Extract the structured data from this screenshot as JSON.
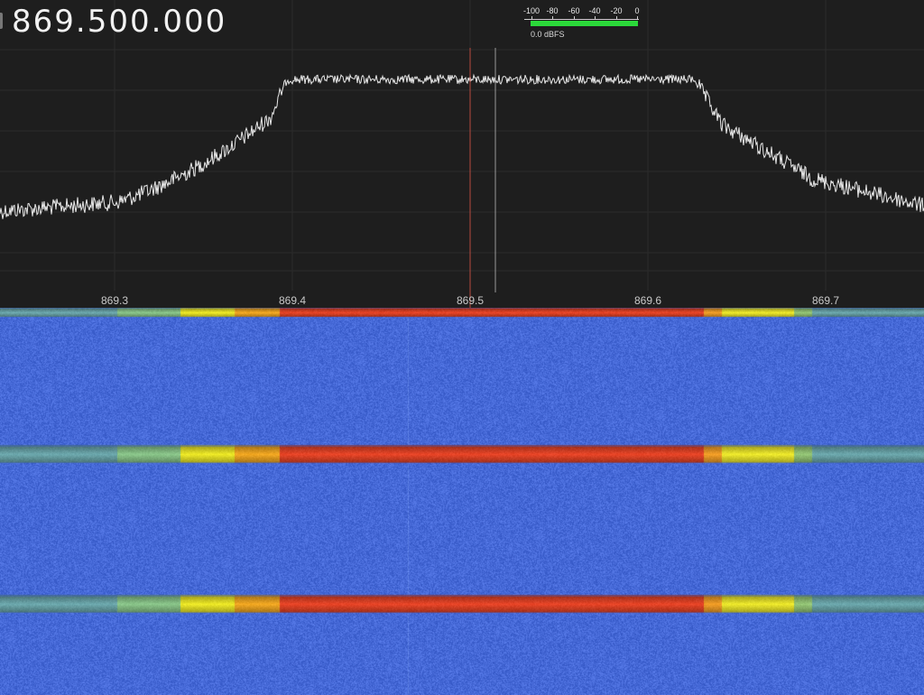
{
  "receiver": {
    "frequency": "869.500.000"
  },
  "level_meter": {
    "ticks": [
      "-100",
      "-80",
      "-60",
      "-40",
      "-20",
      "0"
    ],
    "value_text": "0.0 dBFS",
    "level_fraction": 1.0,
    "bar_color": "#2bd93a"
  },
  "spectrum": {
    "freq_labels": [
      "869.3",
      "869.4",
      "869.5",
      "869.6",
      "869.7"
    ],
    "trace_color": "#e8e8e8",
    "grid_color": "#2c2c2c",
    "tuning_marker_color": "#b84a3f",
    "secondary_marker_color": "#9a9a9a"
  },
  "waterfall": {
    "noise_color": "#3d61d3",
    "signal_colors": [
      "#e8452a",
      "#f0ef2a",
      "#8fc5ad"
    ]
  }
}
